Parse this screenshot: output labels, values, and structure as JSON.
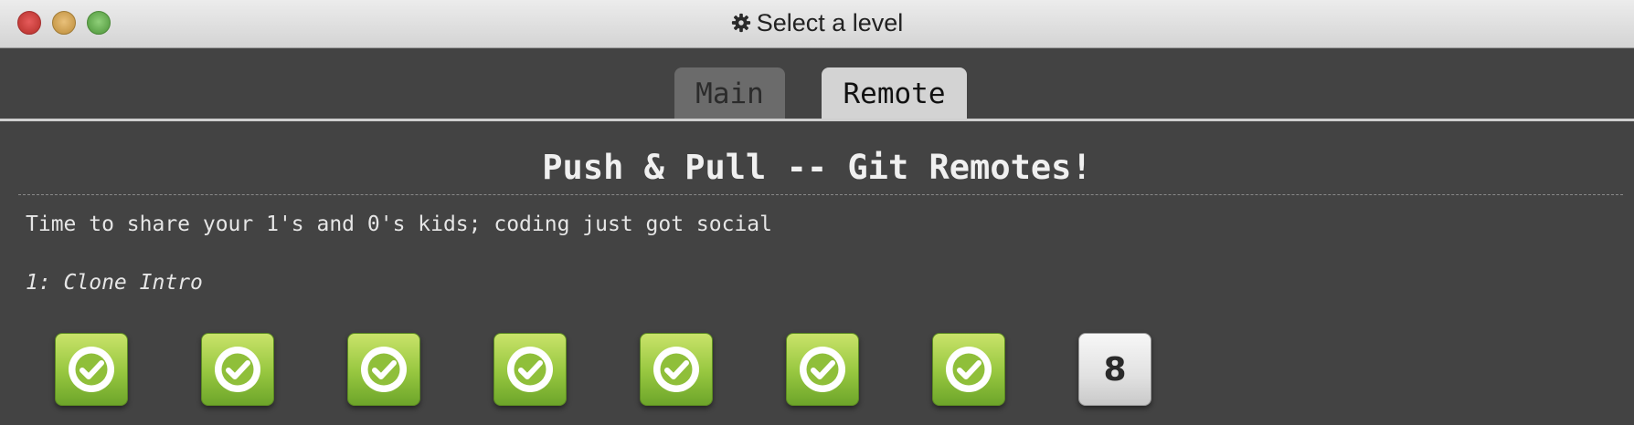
{
  "window": {
    "title": "Select a level",
    "title_icon": "gear-icon",
    "controls": [
      "close",
      "minimize",
      "zoom"
    ]
  },
  "tabs": [
    {
      "label": "Main",
      "selected": false
    },
    {
      "label": "Remote",
      "selected": true
    }
  ],
  "sequence": {
    "title": "Push & Pull -- Git Remotes!",
    "description": "Time to share your 1's and 0's kids; coding just got social",
    "selected_level": "1: Clone Intro"
  },
  "levels": [
    {
      "id": 1,
      "completed": true,
      "icon": "check-icon"
    },
    {
      "id": 2,
      "completed": true,
      "icon": "check-icon"
    },
    {
      "id": 3,
      "completed": true,
      "icon": "check-icon"
    },
    {
      "id": 4,
      "completed": true,
      "icon": "check-icon"
    },
    {
      "id": 5,
      "completed": true,
      "icon": "check-icon"
    },
    {
      "id": 6,
      "completed": true,
      "icon": "check-icon"
    },
    {
      "id": 7,
      "completed": true,
      "icon": "check-icon"
    },
    {
      "id": 8,
      "completed": false,
      "label": "8"
    }
  ],
  "colors": {
    "background": "#434343",
    "completed_green": "#96c63f",
    "pending_gray": "#e1e1e1"
  }
}
